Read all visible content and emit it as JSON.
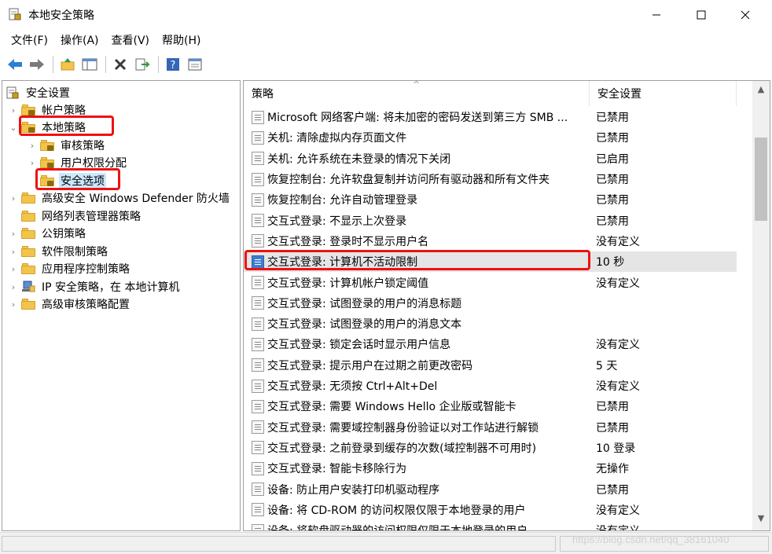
{
  "window": {
    "title": "本地安全策略",
    "icon": "security-policy-icon"
  },
  "menu": [
    "文件(F)",
    "操作(A)",
    "查看(V)",
    "帮助(H)"
  ],
  "toolbar": [
    "back-arrow-icon",
    "forward-arrow-icon",
    "up-folder-icon",
    "show-hide-tree-icon",
    "delete-x-icon",
    "export-list-icon",
    "help-icon",
    "properties-icon"
  ],
  "tree": {
    "root": "安全设置",
    "nodes": [
      {
        "label": "帐户策略",
        "expanded": false
      },
      {
        "label": "本地策略",
        "expanded": true
      },
      {
        "label": "审核策略",
        "expanded": false
      },
      {
        "label": "用户权限分配",
        "expanded": false
      },
      {
        "label": "安全选项",
        "selected": true
      },
      {
        "label": "高级安全 Windows Defender 防火墙",
        "expanded": false
      },
      {
        "label": "网络列表管理器策略"
      },
      {
        "label": "公钥策略",
        "expanded": false
      },
      {
        "label": "软件限制策略",
        "expanded": false
      },
      {
        "label": "应用程序控制策略",
        "expanded": false
      },
      {
        "label": "IP 安全策略，在 本地计算机",
        "expanded": false
      },
      {
        "label": "高级审核策略配置",
        "expanded": false
      }
    ]
  },
  "list": {
    "columns": [
      "策略",
      "安全设置"
    ],
    "sort_glyph": "^",
    "rows": [
      {
        "policy": "Microsoft 网络客户端: 将未加密的密码发送到第三方 SMB ...",
        "setting": "已禁用"
      },
      {
        "policy": "关机: 清除虚拟内存页面文件",
        "setting": "已禁用"
      },
      {
        "policy": "关机: 允许系统在未登录的情况下关闭",
        "setting": "已启用"
      },
      {
        "policy": "恢复控制台: 允许软盘复制并访问所有驱动器和所有文件夹",
        "setting": "已禁用"
      },
      {
        "policy": "恢复控制台: 允许自动管理登录",
        "setting": "已禁用"
      },
      {
        "policy": "交互式登录: 不显示上次登录",
        "setting": "已禁用"
      },
      {
        "policy": "交互式登录: 登录时不显示用户名",
        "setting": "没有定义"
      },
      {
        "policy": "交互式登录: 计算机不活动限制",
        "setting": "10 秒",
        "highlighted": true
      },
      {
        "policy": "交互式登录: 计算机帐户锁定阈值",
        "setting": "没有定义"
      },
      {
        "policy": "交互式登录: 试图登录的用户的消息标题",
        "setting": ""
      },
      {
        "policy": "交互式登录: 试图登录的用户的消息文本",
        "setting": ""
      },
      {
        "policy": "交互式登录: 锁定会话时显示用户信息",
        "setting": "没有定义"
      },
      {
        "policy": "交互式登录: 提示用户在过期之前更改密码",
        "setting": "5 天"
      },
      {
        "policy": "交互式登录: 无须按 Ctrl+Alt+Del",
        "setting": "没有定义"
      },
      {
        "policy": "交互式登录: 需要 Windows Hello 企业版或智能卡",
        "setting": "已禁用"
      },
      {
        "policy": "交互式登录: 需要域控制器身份验证以对工作站进行解锁",
        "setting": "已禁用"
      },
      {
        "policy": "交互式登录: 之前登录到缓存的次数(域控制器不可用时)",
        "setting": "10 登录"
      },
      {
        "policy": "交互式登录: 智能卡移除行为",
        "setting": "无操作"
      },
      {
        "policy": "设备: 防止用户安装打印机驱动程序",
        "setting": "已禁用"
      },
      {
        "policy": "设备: 将 CD-ROM 的访问权限仅限于本地登录的用户",
        "setting": "没有定义"
      },
      {
        "policy": "设备: 将软盘驱动器的访问权限仅限于本地登录的用户",
        "setting": "没有定义"
      }
    ]
  },
  "watermark": "https://blog.csdn.net/qq_38161040",
  "colors": {
    "annotation_red": "#e11111",
    "selection_blue": "#cce8ff",
    "row_highlight": "#e5e5e5",
    "folder_yellow": "#f2c44b"
  }
}
